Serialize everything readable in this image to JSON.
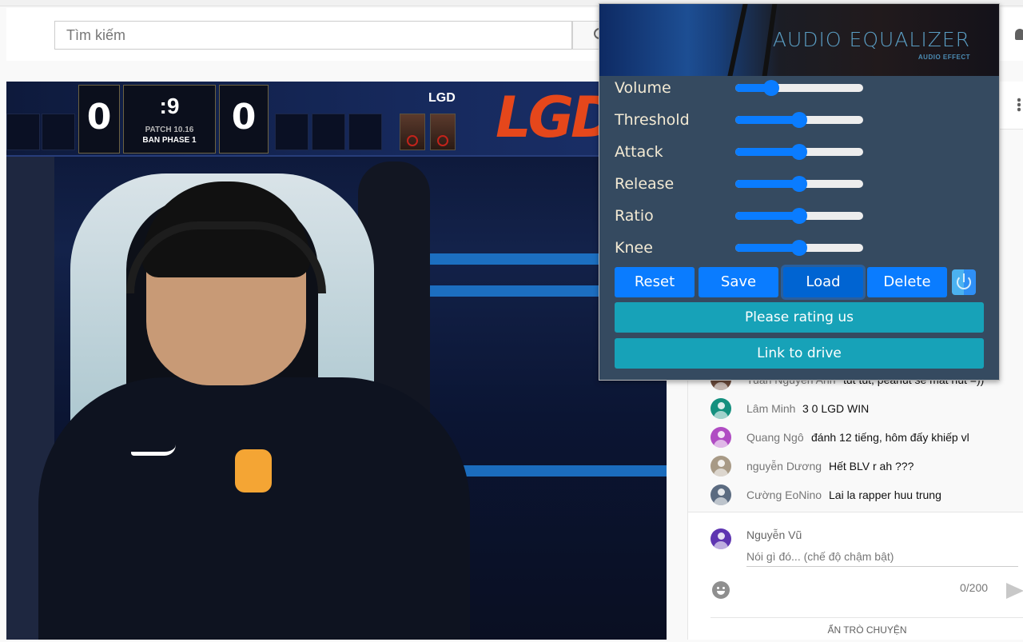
{
  "page": {
    "search": {
      "placeholder": "Tìm kiếm"
    }
  },
  "video": {
    "scoreboard": {
      "left_score": "0",
      "timer": ":9",
      "patch": "PATCH 10.16",
      "phase": "BAN PHASE 1",
      "right_score": "0",
      "team_right": "LGD",
      "team_logo_text": "LGD"
    }
  },
  "equalizer": {
    "title": "AUDIO EQUALIZER",
    "subtitle": "AUDIO EFFECT",
    "sliders": [
      {
        "label": "Volume",
        "value": 0.28
      },
      {
        "label": "Threshold",
        "value": 0.5
      },
      {
        "label": "Attack",
        "value": 0.5
      },
      {
        "label": "Release",
        "value": 0.5
      },
      {
        "label": "Ratio",
        "value": 0.5
      },
      {
        "label": "Knee",
        "value": 0.5
      }
    ],
    "buttons": {
      "reset": "Reset",
      "save": "Save",
      "load": "Load",
      "delete": "Delete"
    },
    "rate_label": "Please rating us",
    "drive_label": "Link to drive",
    "colors": {
      "primary": "#0a7cff",
      "info": "#17a2b8",
      "panel": "#354a60"
    }
  },
  "chat": {
    "messages": [
      {
        "author": "Tuấn Nguyễn Anh",
        "text": "tut tut, peanut sẽ mất nút =))",
        "avatar_color": "#6b4a3a"
      },
      {
        "author": "Lâm Minh",
        "text": "3 0 LGD WIN",
        "avatar_color": "#14907f"
      },
      {
        "author": "Quang Ngô",
        "text": "đánh 12 tiếng, hôm đấy khiếp vl",
        "avatar_color": "#b04cc3"
      },
      {
        "author": "nguyễn Dương",
        "text": "Hết BLV r ah ???",
        "avatar_color": "#a89a86"
      },
      {
        "author": "Cường EoNino",
        "text": "Lai la rapper huu trung",
        "avatar_color": "#5b6b80"
      }
    ],
    "composer": {
      "user": "Nguyễn Vũ",
      "placeholder": "Nói gì đó... (chế độ chậm bật)",
      "counter": "0/200"
    },
    "hide_label": "ẨN TRÒ CHUYỆN"
  }
}
